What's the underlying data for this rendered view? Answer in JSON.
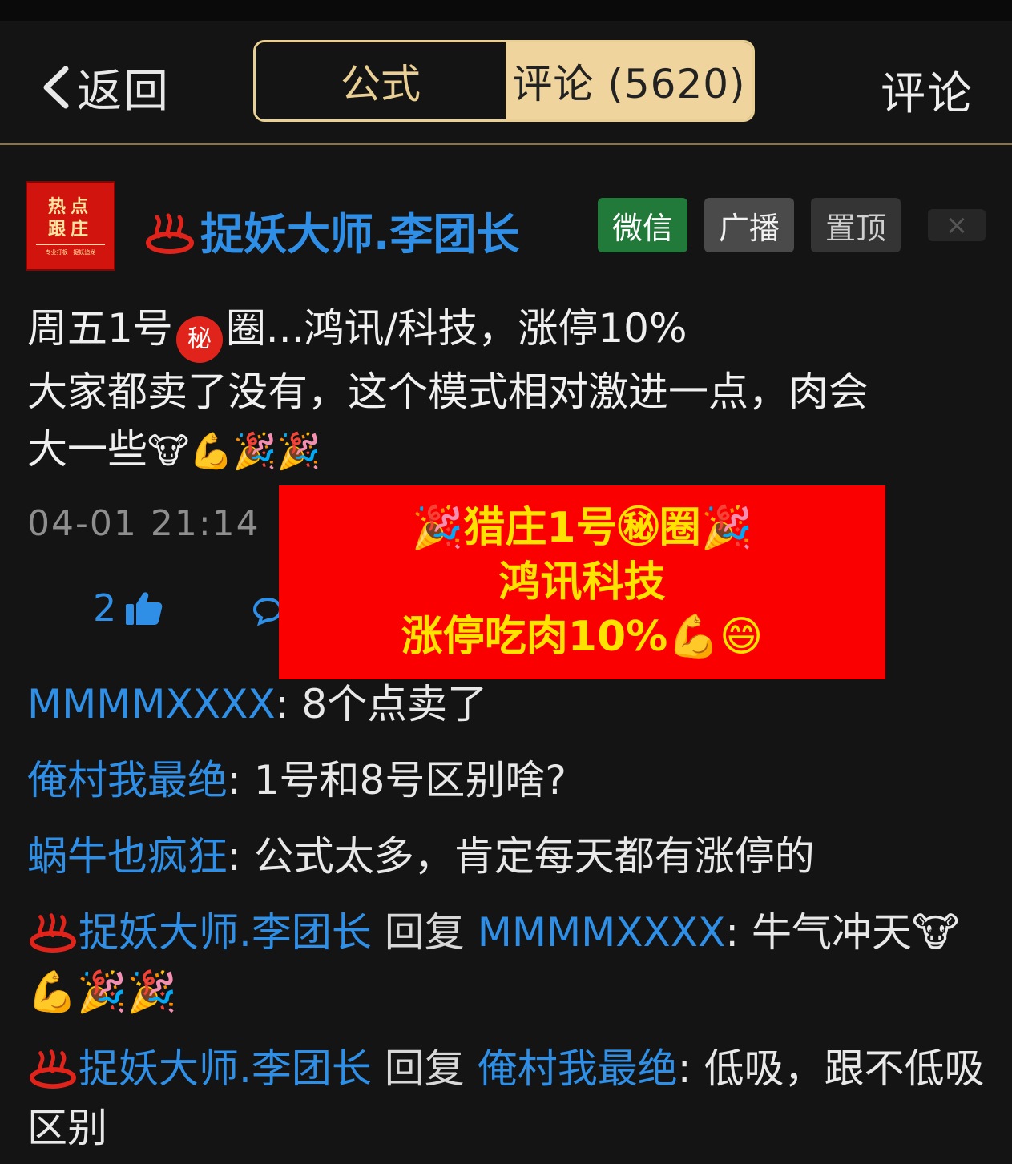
{
  "header": {
    "back_label": "返回",
    "tabs": [
      {
        "label": "公式",
        "active": false
      },
      {
        "label": "评论 (5620)",
        "active": true
      }
    ],
    "right_action": "评论"
  },
  "author": {
    "avatar_text_top": "热点",
    "avatar_text_bottom": "跟庄",
    "avatar_tagline": "专业打板 · 捉妖追龙",
    "name": "捉妖大师.李团长",
    "badges": [
      "微信",
      "广播",
      "置顶"
    ],
    "close": "×"
  },
  "post": {
    "line1_before": "周五1号",
    "secret_mark": "秘",
    "line1_after": "圈...鸿讯/科技，涨停10%",
    "line2": "大家都卖了没有，这个模式相对激进一点，肉会",
    "line3": "大一些",
    "line3_emojis": "🐮💪🎉🎉"
  },
  "meta": {
    "timestamp": "04-01 21:14",
    "likes": "2"
  },
  "banner": {
    "line1": "🎉猎庄1号㊙圈🎉",
    "line2": "鸿讯科技",
    "line3": "涨停吃肉10%💪😄"
  },
  "comments": [
    {
      "user": "MMMMXXXX",
      "text": "8个点卖了"
    },
    {
      "user": "俺村我最绝",
      "text": "1号和8号区别啥?"
    },
    {
      "user": "蜗牛也疯狂",
      "text": "公式太多，肯定每天都有涨停的"
    },
    {
      "user": "捉妖大师.李团长",
      "reply_word": "回复",
      "target": "MMMMXXXX",
      "text": "牛气冲天🐮💪🎉🎉"
    },
    {
      "user": "捉妖大师.李团长",
      "reply_word": "回复",
      "target": "俺村我最绝",
      "text": "低吸，跟不低吸区别"
    }
  ],
  "colors": {
    "background": "#141414",
    "accent_gold": "#f0d49d",
    "link_blue": "#2f8fe6",
    "banner_red": "#fb0000",
    "banner_text": "#ffe300",
    "wechat_green": "#217a3a"
  },
  "icons": [
    "back-chevron-icon",
    "hot-spring-icon",
    "thumbs-up-icon",
    "reply-bubble-icon",
    "close-icon"
  ]
}
